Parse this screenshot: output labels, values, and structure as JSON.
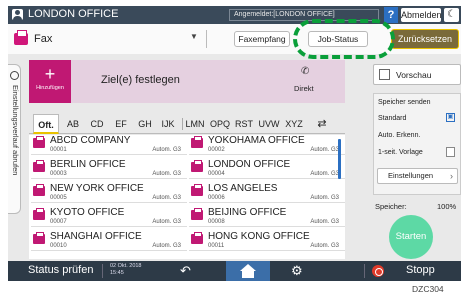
{
  "header": {
    "title": "LONDON OFFICE",
    "login_info": "Angemeldet:[LONDON OFFICE]",
    "help_label": "?",
    "logout_label": "Abmelden",
    "night_icon": "moon-icon"
  },
  "toolbar": {
    "app_label": "Fax",
    "fax_receive_label": "Faxempfang",
    "job_status_label": "Job-Status",
    "reset_label": "Zurücksetzen",
    "reset_color": "#e9c200"
  },
  "history_tab": {
    "label": "Einstellungsverlauf abrufen"
  },
  "destination": {
    "add_label": "Hinzufügen",
    "specify_label": "Ziel(e) festlegen",
    "direct_label": "Direkt",
    "add_color": "#c01873"
  },
  "index_tabs": [
    "Oft.",
    "AB",
    "CD",
    "EF",
    "GH",
    "IJK",
    "LMN",
    "OPQ",
    "RST",
    "UVW",
    "XYZ"
  ],
  "selected_tab": "Oft.",
  "entries": [
    {
      "name": "ABCD COMPANY",
      "number": "00001",
      "mode": "Autom. G3"
    },
    {
      "name": "YOKOHAMA OFFICE",
      "number": "00002",
      "mode": "Autom. G3"
    },
    {
      "name": "BERLIN OFFICE",
      "number": "00003",
      "mode": "Autom. G3"
    },
    {
      "name": "LONDON OFFICE",
      "number": "00004",
      "mode": "Autom. G3"
    },
    {
      "name": "NEW YORK OFFICE",
      "number": "00005",
      "mode": "Autom. G3"
    },
    {
      "name": "LOS ANGELES",
      "number": "00006",
      "mode": "Autom. G3"
    },
    {
      "name": "KYOTO OFFICE",
      "number": "00007",
      "mode": "Autom. G3"
    },
    {
      "name": "BEIJING OFFICE",
      "number": "00008",
      "mode": "Autom. G3"
    },
    {
      "name": "SHANGHAI  OFFICE",
      "number": "00010",
      "mode": "Autom. G3"
    },
    {
      "name": "HONG KONG OFFICE",
      "number": "00011",
      "mode": "Autom. G3"
    }
  ],
  "right_panel": {
    "preview_label": "Vorschau",
    "memory_send": "Speicher senden",
    "standard": "Standard",
    "auto_detect": "Auto. Erkenn.",
    "one_side": "1-seit. Vorlage",
    "settings_label": "Einstellungen",
    "memory_label": "Speicher:",
    "memory_value": "100%",
    "start_label": "Starten",
    "start_color": "#5dd9a5"
  },
  "bottom_bar": {
    "status_label": "Status prüfen",
    "date": "02 Okt. 2018",
    "time": "15:45",
    "stop_label": "Stopp"
  },
  "caption": "DZC304"
}
